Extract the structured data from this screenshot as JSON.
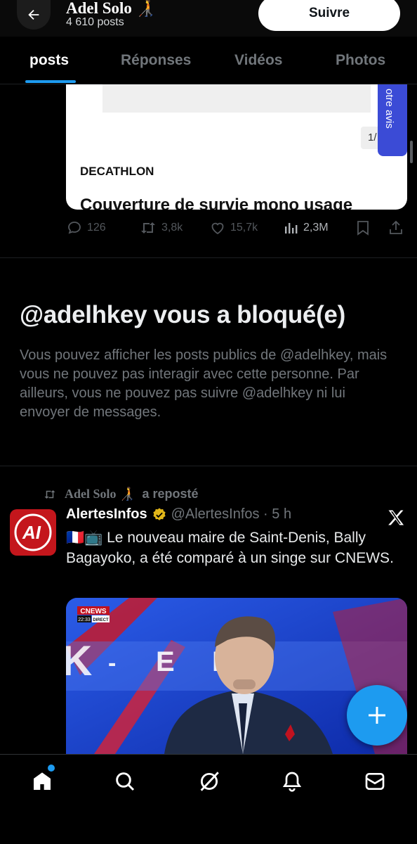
{
  "header": {
    "name": "Adel Solo 🧑‍🦯",
    "post_count": "4 610 posts",
    "follow_label": "Suivre"
  },
  "tabs": [
    "posts",
    "Réponses",
    "Vidéos",
    "Photos"
  ],
  "ad": {
    "pager": "1/",
    "brand": "DECATHLON",
    "title": "Couverture de survie mono usage",
    "side_label": "otre avis"
  },
  "actions": {
    "replies": "126",
    "reposts": "3,8k",
    "likes": "15,7k",
    "views": "2,3M"
  },
  "blocked": {
    "title": "@adelhkey vous a bloqué(e)",
    "text": "Vous pouvez afficher les posts publics de @adelhkey, mais vous ne pouvez pas interagir avec cette personne. Par ailleurs, vous ne pouvez pas suivre @adelhkey ni lui envoyer de messages."
  },
  "repost": {
    "name": "Adel Solo 🧑‍🦯",
    "suffix": "a reposté"
  },
  "tweet": {
    "avatar_text": "AI",
    "name": "AlertesInfos",
    "handle_time": "@AlertesInfos · 5 h",
    "text": "🇫🇷📺 Le nouveau maire de Saint-Denis, Bally Bagayoko, a été comparé à un singe sur CNEWS.",
    "media": {
      "channel": "CNEWS",
      "time": "22:33",
      "live": "DIRECT"
    }
  },
  "colors": {
    "accent": "#1d9bf0",
    "background": "#000000",
    "muted": "#71767b",
    "verified": "#e2b719"
  },
  "bottom_nav": [
    "home-icon",
    "search-icon",
    "grok-icon",
    "bell-icon",
    "messages-icon"
  ]
}
